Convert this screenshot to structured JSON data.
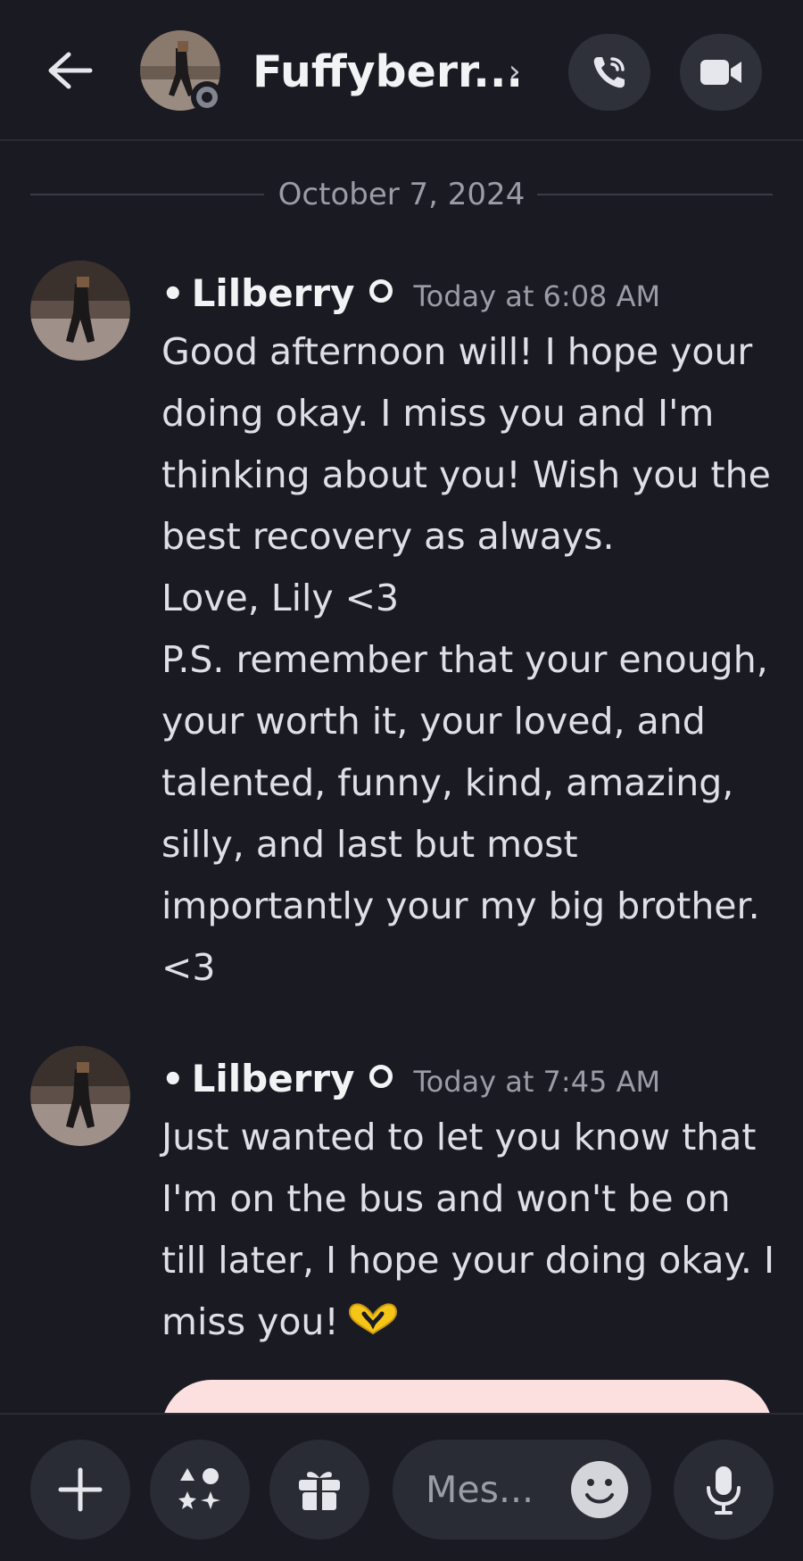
{
  "header": {
    "title": "Fuffyberr...",
    "chevron": "›",
    "back_icon": "arrow-left-icon",
    "call_icon": "phone-call-icon",
    "video_icon": "video-camera-icon"
  },
  "date_divider": "October 7, 2024",
  "messages": [
    {
      "bullet": "•",
      "author": "Lilberry",
      "time": "Today at 6:08 AM",
      "text": "Good afternoon will! I hope your doing okay. I miss you and I'm thinking about you! Wish you the best recovery as always.\nLove, Lily <3\nP.S. remember that your enough, your worth it, your loved, and talented, funny, kind, amazing, silly, and last but most importantly your my big brother. <3"
    },
    {
      "bullet": "•",
      "author": "Lilberry",
      "time": "Today at 7:45 AM",
      "text": "Just wanted to let you know that I'm on the bus and won't be on till later, I hope your doing okay. I miss you!",
      "emoji": "heart-hands-emoji"
    }
  ],
  "composer": {
    "placeholder": "Mes...",
    "plus_icon": "plus-icon",
    "apps_icon": "apps-icon",
    "gift_icon": "gift-icon",
    "emoji_icon": "emoji-icon",
    "mic_icon": "microphone-icon"
  },
  "colors": {
    "background": "#1a1b22",
    "button": "#2a2c35",
    "card_pink": "#fce0e0",
    "heart_yellow": "#f5c518"
  }
}
